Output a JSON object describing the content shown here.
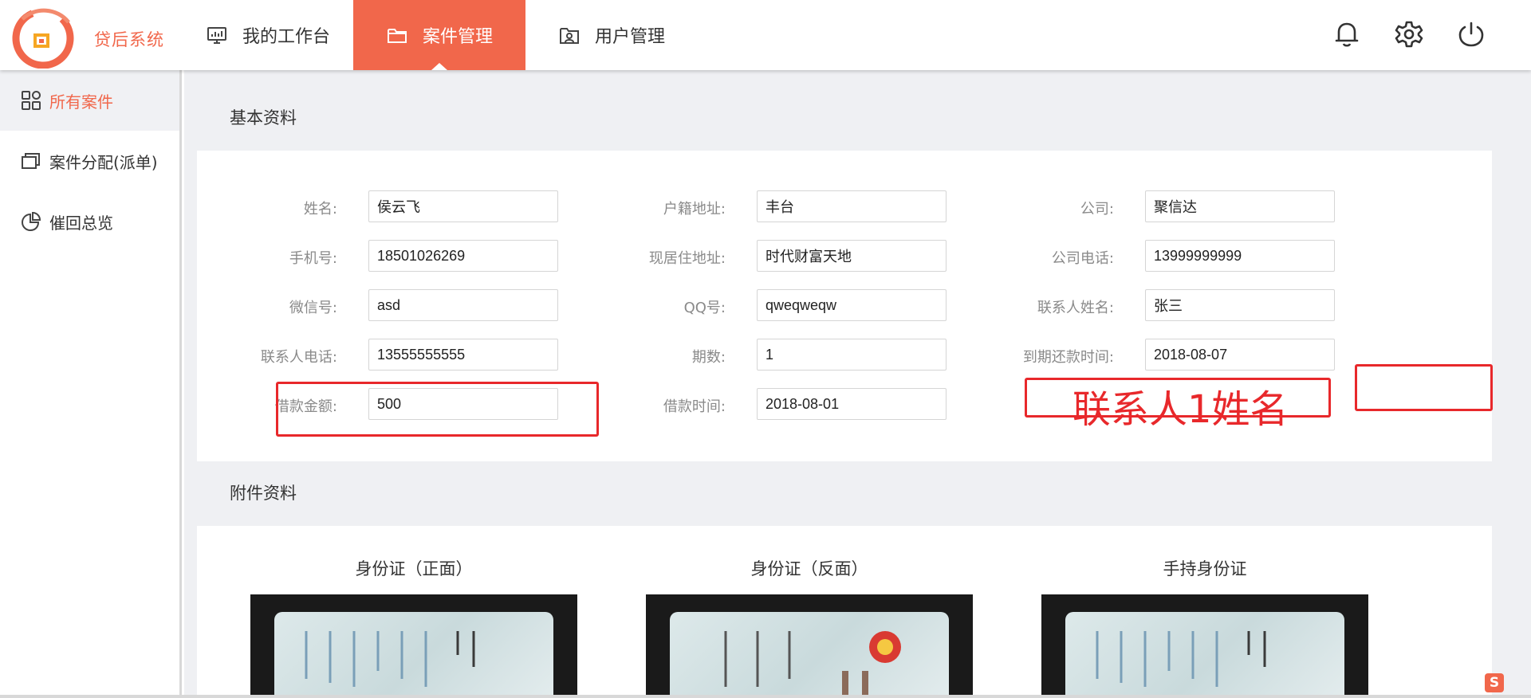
{
  "app": {
    "brand": "贷后系统"
  },
  "nav": [
    {
      "label": "我的工作台",
      "icon": "monitor-chart-icon"
    },
    {
      "label": "案件管理",
      "icon": "folder-icon"
    },
    {
      "label": "用户管理",
      "icon": "user-card-icon"
    }
  ],
  "header_icons": [
    "bell-icon",
    "gear-icon",
    "power-icon"
  ],
  "sidebar": [
    {
      "label": "所有案件",
      "icon": "grid-icon",
      "active": true
    },
    {
      "label": "案件分配(派单)",
      "icon": "cards-icon",
      "active": false
    },
    {
      "label": "催回总览",
      "icon": "pie-icon",
      "active": false
    }
  ],
  "basic": {
    "title": "基本资料",
    "fields": [
      {
        "label": "姓名:",
        "value": "侯云飞"
      },
      {
        "label": "户籍地址:",
        "value": "丰台"
      },
      {
        "label": "公司:",
        "value": "聚信达"
      },
      {
        "label": "手机号:",
        "value": "18501026269"
      },
      {
        "label": "现居住地址:",
        "value": "时代财富天地"
      },
      {
        "label": "公司电话:",
        "value": "13999999999"
      },
      {
        "label": "微信号:",
        "value": "asd"
      },
      {
        "label": "QQ号:",
        "value": "qweqweqw"
      },
      {
        "label": "联系人姓名:",
        "value": "张三"
      },
      {
        "label": "联系人电话:",
        "value": "13555555555"
      },
      {
        "label": "期数:",
        "value": "1"
      },
      {
        "label": "到期还款时间:",
        "value": "2018-08-07"
      },
      {
        "label": "借款金额:",
        "value": "500"
      },
      {
        "label": "借款时间:",
        "value": "2018-08-01"
      }
    ]
  },
  "annotation": {
    "text": "联系人1姓名",
    "color": "#e8282b"
  },
  "attachments": {
    "title": "附件资料",
    "items": [
      {
        "label": "身份证（正面）"
      },
      {
        "label": "身份证（反面）"
      },
      {
        "label": "手持身份证"
      }
    ]
  },
  "colors": {
    "accent": "#f1674b",
    "annotation": "#e8282b",
    "content_bg": "#eff0f3"
  }
}
